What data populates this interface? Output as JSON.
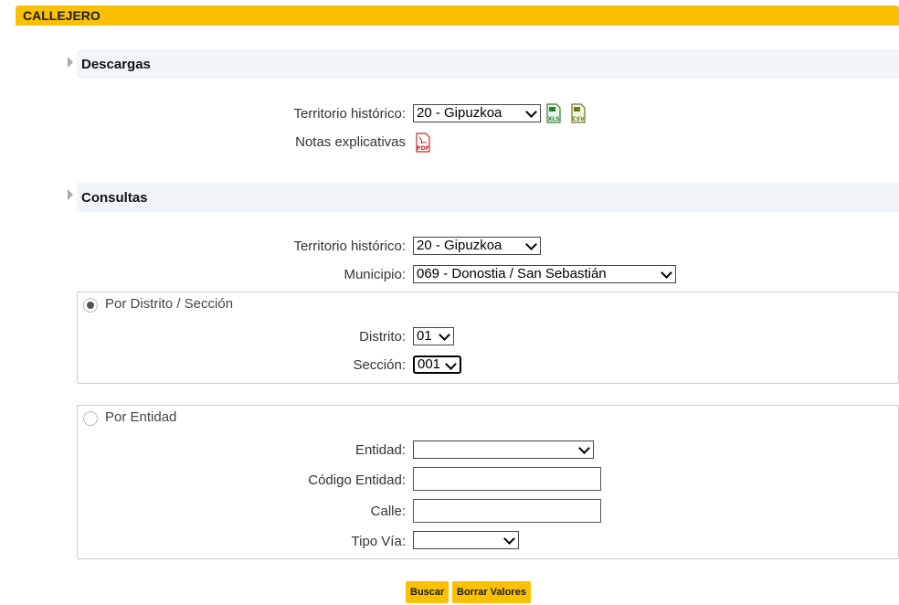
{
  "title": "CALLEJERO",
  "descargas": {
    "header": "Descargas",
    "territorio_label": "Territorio histórico:",
    "territorio_value": "20 - Gipuzkoa",
    "xls_icon_text": "XLS",
    "csv_icon_text": "CSV",
    "notas_label": "Notas explicativas",
    "pdf_icon_text": "PDF"
  },
  "consultas": {
    "header": "Consultas",
    "territorio_label": "Territorio histórico:",
    "territorio_value": "20 - Gipuzkoa",
    "municipio_label": "Municipio:",
    "municipio_value": "069 - Donostia / San Sebastián",
    "distrito_panel": {
      "option_label": "Por Distrito / Sección",
      "selected": true,
      "distrito_label": "Distrito:",
      "distrito_value": "01",
      "seccion_label": "Sección:",
      "seccion_value": "001"
    },
    "entidad_panel": {
      "option_label": "Por Entidad",
      "selected": false,
      "entidad_label": "Entidad:",
      "entidad_value": "",
      "codigo_label": "Código Entidad:",
      "codigo_value": "",
      "calle_label": "Calle:",
      "calle_value": "",
      "tipo_via_label": "Tipo Vía:",
      "tipo_via_value": ""
    }
  },
  "buttons": {
    "buscar": "Buscar",
    "borrar": "Borrar Valores"
  },
  "colors": {
    "accent": "#f9c100",
    "xls_green": "#2e7d32",
    "csv_olive": "#6b7a1e",
    "pdf_red": "#c62828"
  }
}
